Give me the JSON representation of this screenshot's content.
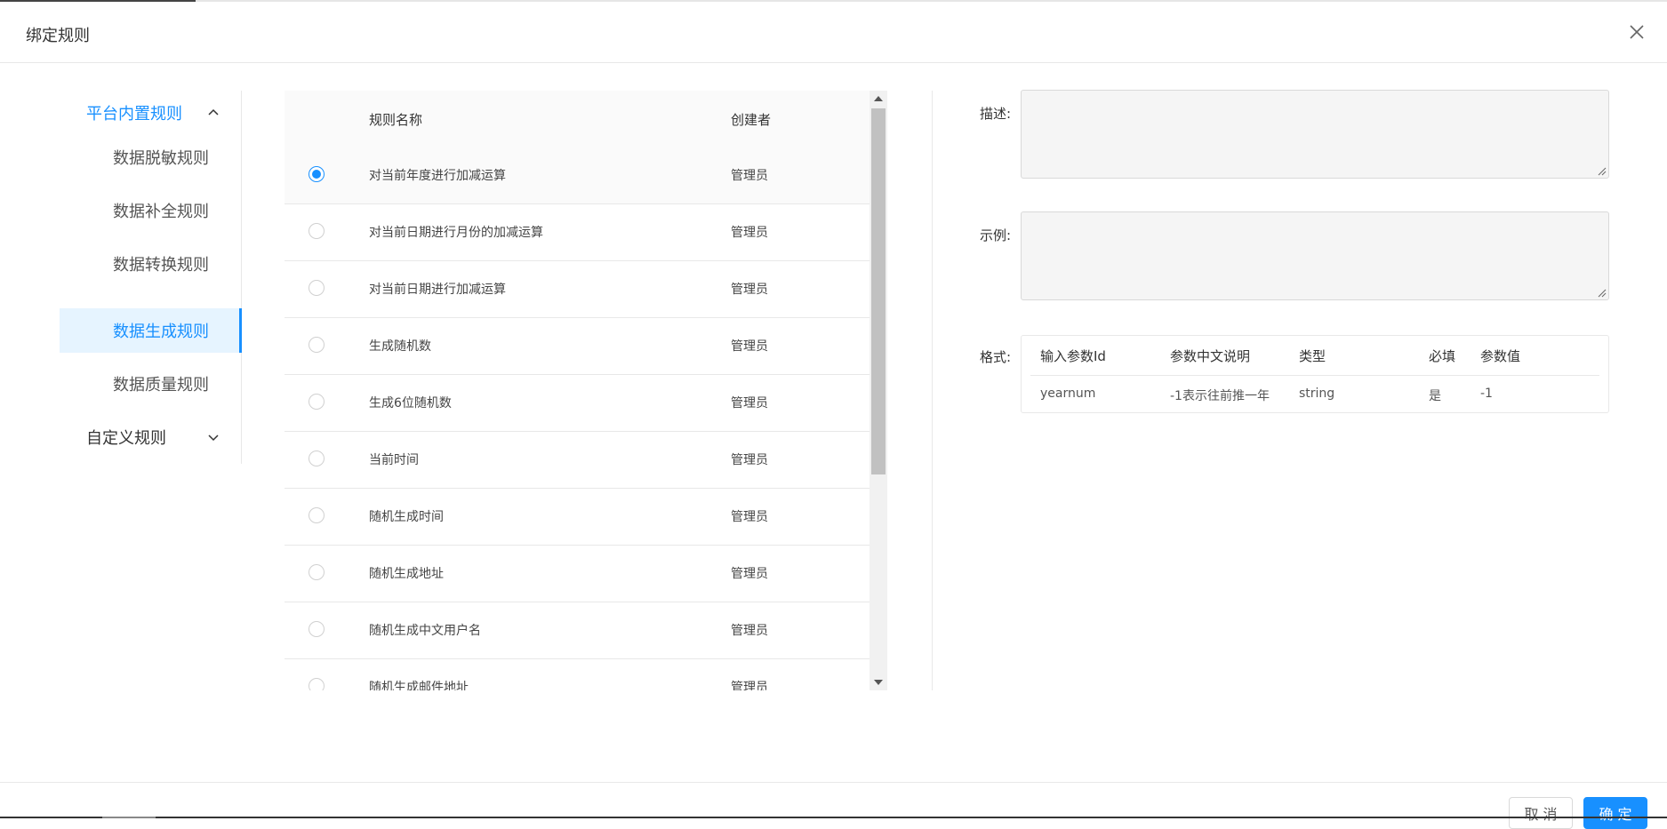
{
  "dialog": {
    "title": "绑定规则"
  },
  "menu": {
    "group_builtin": "平台内置规则",
    "items": [
      {
        "label": "数据脱敏规则"
      },
      {
        "label": "数据补全规则"
      },
      {
        "label": "数据转换规则"
      },
      {
        "label": "数据生成规则"
      },
      {
        "label": "数据质量规则"
      }
    ],
    "group_custom": "自定义规则",
    "active_index": 3
  },
  "table": {
    "columns": {
      "name": "规则名称",
      "creator": "创建者"
    },
    "rows": [
      {
        "name": "对当前年度进行加减运算",
        "creator": "管理员",
        "selected": true
      },
      {
        "name": "对当前日期进行月份的加减运算",
        "creator": "管理员",
        "selected": false
      },
      {
        "name": "对当前日期进行加减运算",
        "creator": "管理员",
        "selected": false
      },
      {
        "name": "生成随机数",
        "creator": "管理员",
        "selected": false
      },
      {
        "name": "生成6位随机数",
        "creator": "管理员",
        "selected": false
      },
      {
        "name": "当前时间",
        "creator": "管理员",
        "selected": false
      },
      {
        "name": "随机生成时间",
        "creator": "管理员",
        "selected": false
      },
      {
        "name": "随机生成地址",
        "creator": "管理员",
        "selected": false
      },
      {
        "name": "随机生成中文用户名",
        "creator": "管理员",
        "selected": false
      },
      {
        "name": "随机生成邮件地址",
        "creator": "管理员",
        "selected": false
      }
    ]
  },
  "detail": {
    "desc_label": "描述:",
    "desc_value": "",
    "example_label": "示例:",
    "example_value": "",
    "format_label": "格式:",
    "format_columns": {
      "param_id": "输入参数Id",
      "param_desc": "参数中文说明",
      "type": "类型",
      "required": "必填",
      "value": "参数值"
    },
    "format_rows": [
      {
        "param_id": "yearnum",
        "param_desc": "-1表示往前推一年",
        "type": "string",
        "required": "是",
        "value": "-1"
      }
    ]
  },
  "footer": {
    "cancel_label": "取 消",
    "ok_label": "确 定"
  },
  "colors": {
    "primary": "#1890ff",
    "active_bg": "#e6f4ff"
  }
}
